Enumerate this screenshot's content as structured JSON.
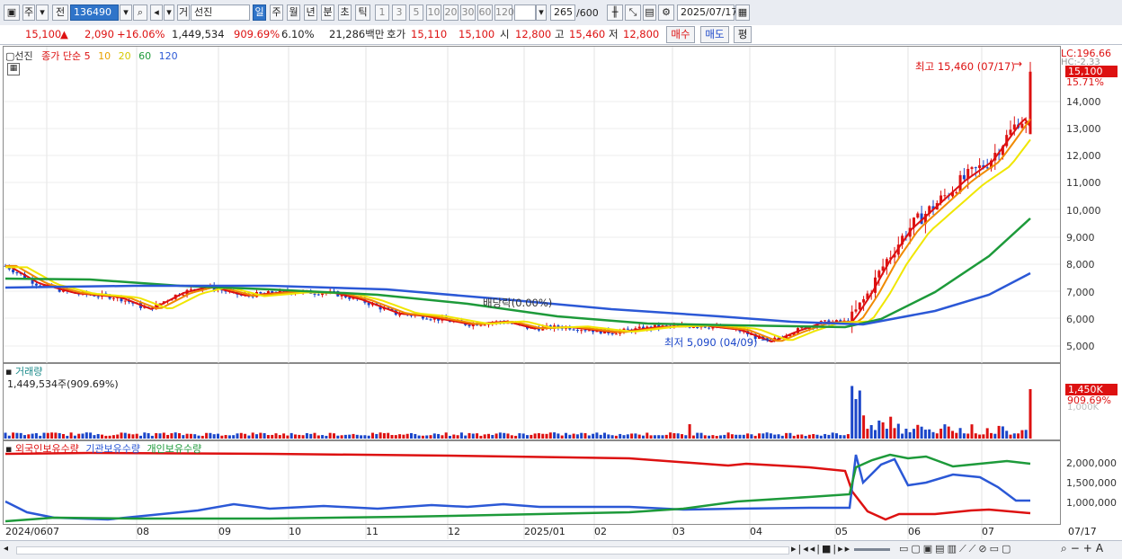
{
  "toolbar": {
    "market": "주",
    "kind": "전",
    "code": "136490",
    "item_kind": "거",
    "stock_name": "선진",
    "periods": [
      "일",
      "주",
      "월",
      "년",
      "분",
      "초",
      "틱"
    ],
    "active_period": "일",
    "intervals": [
      "1",
      "3",
      "5",
      "10",
      "20",
      "30",
      "60",
      "120"
    ],
    "count": "265",
    "count_max": "/600",
    "date": "2025/07/17"
  },
  "quote": {
    "price": "15,100",
    "change": "2,090",
    "change_pct": "+16.06%",
    "volume": "1,449,534",
    "volume_ratio": "909.69%",
    "turnover_rate": "6.10%",
    "amount": "21,286백만",
    "bid_label": "호가",
    "bid": "15,110",
    "ask": "15,100",
    "open_label": "시",
    "open": "12,800",
    "high_label": "고",
    "high": "15,460",
    "low_label": "저",
    "low": "12,800",
    "buy_label": "매수",
    "sell_label": "매도",
    "avg_label": "평"
  },
  "price_pane": {
    "legend_name": "선진",
    "legend_main": "종가 단순 5",
    "ma_labels": [
      "10",
      "20",
      "60",
      "120"
    ],
    "ma_colors": [
      "#e8a200",
      "#e6e600",
      "#1d9a3a",
      "#2b58d6"
    ],
    "lc_label": "LC:196.66",
    "hc_label": "HC:-2.33",
    "price_tag": "15,100",
    "pct_tag": "15.71%",
    "high_note": "최고 15,460 (07/17)",
    "low_note": "최저 5,090 (04/09)",
    "div_note": "배당락(0.00%)",
    "y_ticks": [
      "14,000",
      "13,000",
      "12,000",
      "11,000",
      "10,000",
      "9,000",
      "8,000",
      "7,000",
      "6,000",
      "5,000"
    ]
  },
  "volume_pane": {
    "title": "거래량",
    "value": "1,449,534주(909.69%)",
    "tag_value": "1,450K",
    "tag_pct": "909.69%",
    "hidden_tick": "1,000K"
  },
  "holdings_pane": {
    "legend": [
      "외국인보유수량",
      "기관보유수량",
      "개인보유수량"
    ],
    "colors": [
      "#d11",
      "#2b58d6",
      "#1d9a3a"
    ],
    "y_ticks": [
      "2,000,000",
      "1,500,000",
      "1,000,000"
    ]
  },
  "x_axis": {
    "labels": [
      "2024/06",
      "07",
      "08",
      "09",
      "10",
      "11",
      "12",
      "2025/01",
      "02",
      "03",
      "04",
      "05",
      "06",
      "07"
    ],
    "last_date": "07/17"
  },
  "colors": {
    "up": "#dd1111",
    "down": "#1b46c9",
    "ma5": "#dd1111"
  }
}
